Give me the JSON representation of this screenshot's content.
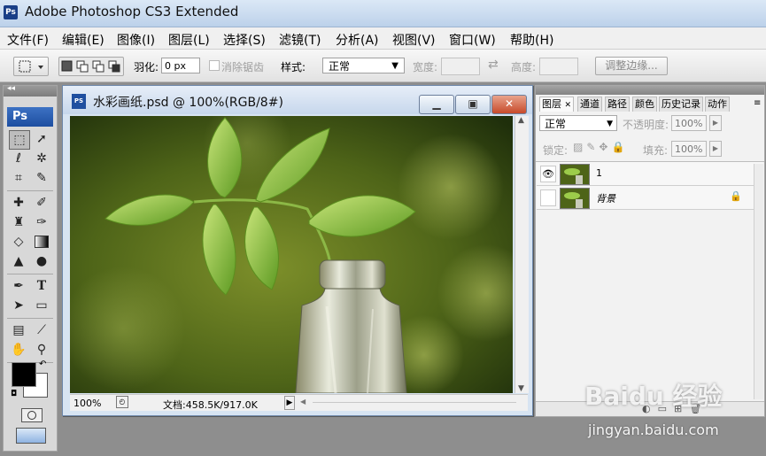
{
  "app": {
    "title": "Adobe Photoshop CS3 Extended",
    "logo": "Ps"
  },
  "menu": [
    "文件(F)",
    "编辑(E)",
    "图像(I)",
    "图层(L)",
    "选择(S)",
    "滤镜(T)",
    "分析(A)",
    "视图(V)",
    "窗口(W)",
    "帮助(H)"
  ],
  "options": {
    "feather_label": "羽化:",
    "feather_value": "0 px",
    "antialias_label": "消除锯齿",
    "style_label": "样式:",
    "style_value": "正常",
    "width_label": "宽度:",
    "height_label": "高度:",
    "refine_edge_label": "调整边缘..."
  },
  "toolbox": {
    "logo": "Ps"
  },
  "document": {
    "title": "水彩画纸.psd @ 100%(RGB/8#)",
    "zoom": "100%",
    "doc_info": "文档:458.5K/917.0K"
  },
  "layers_panel": {
    "tabs": [
      "图层",
      "通道",
      "路径",
      "颜色",
      "历史记录",
      "动作"
    ],
    "blend_mode": "正常",
    "opacity_label": "不透明度:",
    "opacity_value": "100%",
    "lock_label": "锁定:",
    "fill_label": "填充:",
    "fill_value": "100%",
    "layers": [
      {
        "name": "1",
        "visible": true
      },
      {
        "name": "背景",
        "visible": false,
        "locked": true
      }
    ]
  },
  "watermark": {
    "text": "jingyan.baidu.com",
    "logo_text": "Baidu 经验"
  }
}
